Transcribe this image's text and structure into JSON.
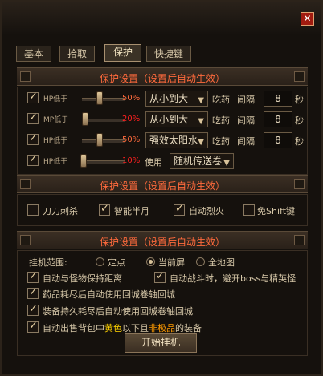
{
  "window": {
    "close_icon": "close-icon"
  },
  "tabs": [
    {
      "label": "基本",
      "active": false
    },
    {
      "label": "拾取",
      "active": false
    },
    {
      "label": "保护",
      "active": true
    },
    {
      "label": "快捷键",
      "active": false
    }
  ],
  "protect1": {
    "title": "保护设置（设置后自动生效）",
    "rows": [
      {
        "checked": true,
        "label": "HP低于",
        "percent": "50%",
        "percent_color": "#ff6a3c",
        "level": 0.5,
        "select": "从小到大",
        "eat": "吃药",
        "interval_label": "间隔",
        "interval": "8",
        "unit": "秒"
      },
      {
        "checked": true,
        "label": "MP低于",
        "percent": "20%",
        "percent_color": "#ff2020",
        "level": 0.2,
        "select": "从小到大",
        "eat": "吃药",
        "interval_label": "间隔",
        "interval": "8",
        "unit": "秒"
      },
      {
        "checked": true,
        "label": "HP低于",
        "percent": "50%",
        "percent_color": "#ff6a3c",
        "level": 0.5,
        "select": "强效太阳水",
        "eat": "吃药",
        "interval_label": "间隔",
        "interval": "8",
        "unit": "秒"
      },
      {
        "checked": true,
        "label": "HP低于",
        "percent": "10%",
        "percent_color": "#ff2020",
        "level": 0.1,
        "use": "使用",
        "select": "随机传送卷"
      }
    ]
  },
  "protect2": {
    "title": "保护设置（设置后自动生效）",
    "options": [
      {
        "checked": false,
        "label": "刀刀刺杀"
      },
      {
        "checked": true,
        "label": "智能半月"
      },
      {
        "checked": true,
        "label": "自动烈火"
      },
      {
        "checked": false,
        "label": "免Shift键"
      }
    ]
  },
  "protect3": {
    "title": "保护设置（设置后自动生效）",
    "range_label": "挂机范围:",
    "ranges": [
      {
        "label": "定点",
        "selected": false
      },
      {
        "label": "当前屏",
        "selected": true
      },
      {
        "label": "全地图",
        "selected": false
      }
    ],
    "opt_keep_distance": "自动与怪物保持距离",
    "opt_avoid_boss": "自动战斗时，避开boss与精英怪",
    "opt_potion_out": "药品耗尽后自动使用回城卷轴回城",
    "opt_durability": "装备持久耗尽后自动使用回城卷轴回城",
    "sell_prefix": "自动出售背包中",
    "sell_color1": "黄色",
    "sell_mid": "以下且",
    "sell_color2": "非极品",
    "sell_suffix": "的装备"
  },
  "start_button": "开始挂机"
}
